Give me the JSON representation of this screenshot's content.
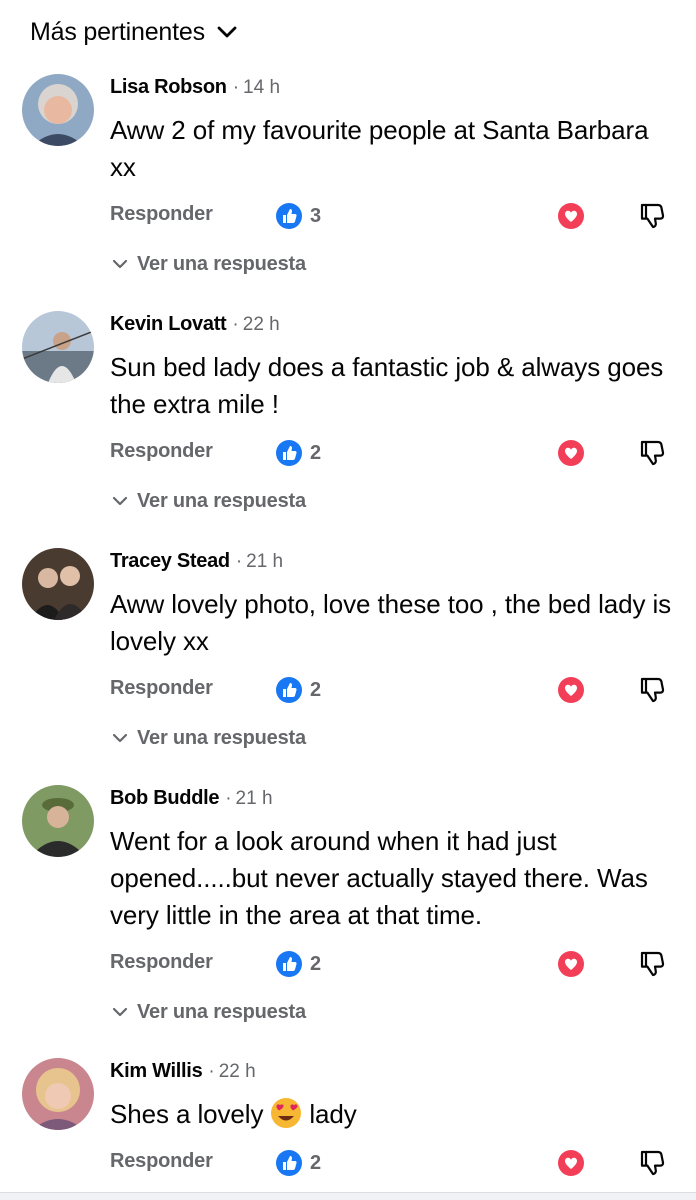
{
  "sort": {
    "label": "Más pertinentes",
    "icon": "chevron-down-icon"
  },
  "labels": {
    "reply": "Responder",
    "view_replies": "Ver una respuesta"
  },
  "colors": {
    "like_blue": "#1877f2",
    "heart_red": "#f33e58",
    "secondary_text": "#65676b"
  },
  "comments": [
    {
      "author": "Lisa Robson",
      "time": "14 h",
      "text": "Aww 2 of my favourite people at Santa Barbara  xx",
      "likes": "3",
      "has_replies": true
    },
    {
      "author": "Kevin Lovatt",
      "time": "22 h",
      "text": "Sun bed lady does a fantastic job & always goes the extra mile !",
      "likes": "2",
      "has_replies": true
    },
    {
      "author": "Tracey Stead",
      "time": "21 h",
      "text": "Aww lovely photo, love these too , the bed lady is lovely xx",
      "likes": "2",
      "has_replies": true
    },
    {
      "author": "Bob Buddle",
      "time": "21 h",
      "text": "Went for a look around when it had just opened.....but never actually stayed there. Was very little in the area at that time.",
      "likes": "2",
      "has_replies": true
    },
    {
      "author": "Kim Willis",
      "time": "22 h",
      "text_before": "Shes a lovely",
      "emoji": "heart-eyes-emoji",
      "text_after": "lady",
      "likes": "2",
      "has_replies": false
    }
  ]
}
